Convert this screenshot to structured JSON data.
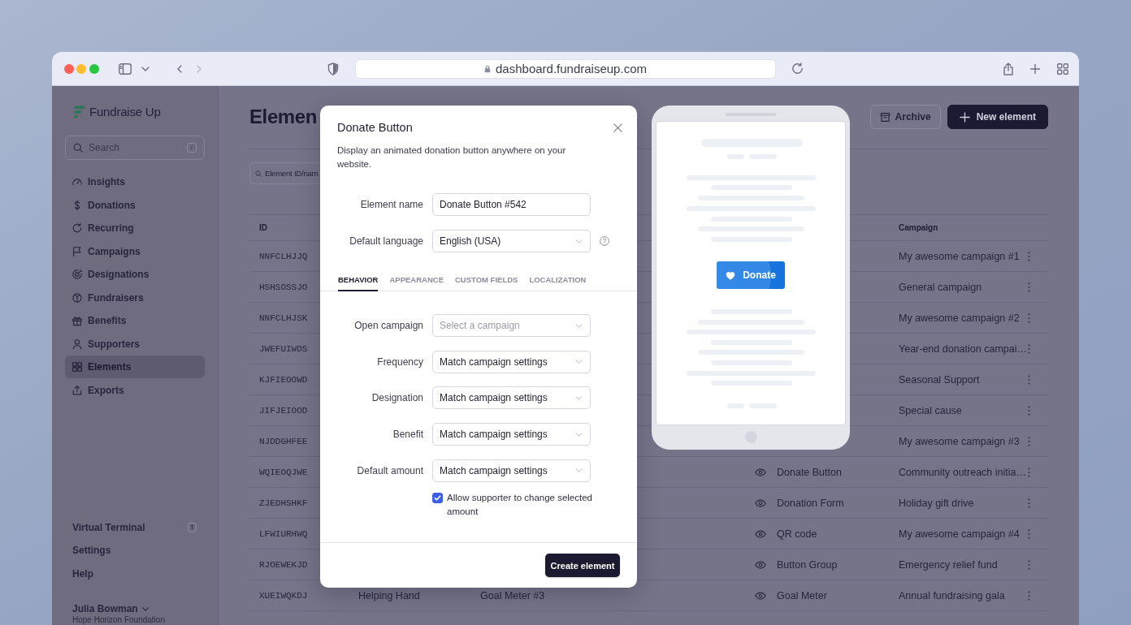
{
  "browser": {
    "url": "dashboard.fundraiseup.com"
  },
  "sidebar": {
    "brand": "Fundraise Up",
    "search": {
      "placeholder": "Search",
      "shortcut": "/"
    },
    "items": [
      {
        "label": "Insights",
        "selected": false
      },
      {
        "label": "Donations",
        "selected": false
      },
      {
        "label": "Recurring",
        "selected": false
      },
      {
        "label": "Campaigns",
        "selected": false
      },
      {
        "label": "Designations",
        "selected": false
      },
      {
        "label": "Fundraisers",
        "selected": false
      },
      {
        "label": "Benefits",
        "selected": false
      },
      {
        "label": "Supporters",
        "selected": false
      },
      {
        "label": "Elements",
        "selected": true
      },
      {
        "label": "Exports",
        "selected": false
      }
    ],
    "footer_items": [
      {
        "label": "Virtual Terminal",
        "shortcut": "T"
      },
      {
        "label": "Settings"
      },
      {
        "label": "Help"
      }
    ],
    "user": {
      "name": "Julia Bowman",
      "organization": "Hope Horizon Foundation"
    }
  },
  "page": {
    "title": "Elemen",
    "filter": {
      "placeholder": "Element ID/nam"
    },
    "actions": [
      {
        "label": "Archive",
        "kind": "archive"
      },
      {
        "label": "New element",
        "kind": "create"
      }
    ]
  },
  "table": {
    "headers": {
      "id": "ID",
      "campaign": "Campaign"
    },
    "rows": [
      {
        "id": "NNFCLHJJQ",
        "campaign": "My awesome campaign #1"
      },
      {
        "id": "HSHSOSSJO",
        "campaign": "General campaign"
      },
      {
        "id": "NNFCLHJSK",
        "campaign": "My awesome campaign #2"
      },
      {
        "id": "JWEFUIWDS",
        "campaign": "Year-end donation campai…"
      },
      {
        "id": "KJFIEOOWD",
        "campaign": "Seasonal Support"
      },
      {
        "id": "JIFJEIOOD",
        "campaign": "Special cause"
      },
      {
        "id": "NJDDGHFEE",
        "campaign": "My awesome campaign #3"
      },
      {
        "id": "WQIEOQJWE",
        "column_4": "Donate Button",
        "campaign": "Community outreach initia…"
      },
      {
        "id": "ZJEDHSHKF",
        "column_4": "Donation Form",
        "campaign": "Holiday gift drive"
      },
      {
        "id": "LFWIURHWQ",
        "column_4": "QR code",
        "campaign": "My awesome campaign #4"
      },
      {
        "id": "RJOEWEKJD",
        "column_4": "Button Group",
        "campaign": "Emergency relief fund"
      },
      {
        "id": "XUEIWQKDJ",
        "column_2": "Helping Hand",
        "column_3": "Goal Meter #3",
        "column_4": "Goal Meter",
        "campaign": "Annual fundraising gala"
      }
    ]
  },
  "modal": {
    "title": "Donate Button",
    "description": "Display an animated donation button anywhere on your website.",
    "fields": [
      {
        "label": "Element name",
        "kind": "text",
        "value": "Donate Button #542"
      },
      {
        "label": "Default language",
        "kind": "select",
        "value": "English (USA)",
        "help": true
      }
    ],
    "tabs": [
      {
        "label": "BEHAVIOR",
        "selected": true
      },
      {
        "label": "APPEARANCE",
        "selected": false
      },
      {
        "label": "CUSTOM FIELDS",
        "selected": false
      },
      {
        "label": "LOCALIZATION",
        "selected": false
      }
    ],
    "settings": [
      {
        "label": "Open campaign",
        "placeholder": "Select a campaign"
      },
      {
        "label": "Frequency",
        "value": "Match campaign settings"
      },
      {
        "label": "Designation",
        "value": "Match campaign settings"
      },
      {
        "label": "Benefit",
        "value": "Match campaign settings"
      },
      {
        "label": "Default amount",
        "value": "Match campaign settings"
      }
    ],
    "checkbox": {
      "label": "Allow supporter to change selected amount",
      "checked": true
    },
    "submit": "Create element"
  },
  "preview": {
    "button": "Donate"
  }
}
